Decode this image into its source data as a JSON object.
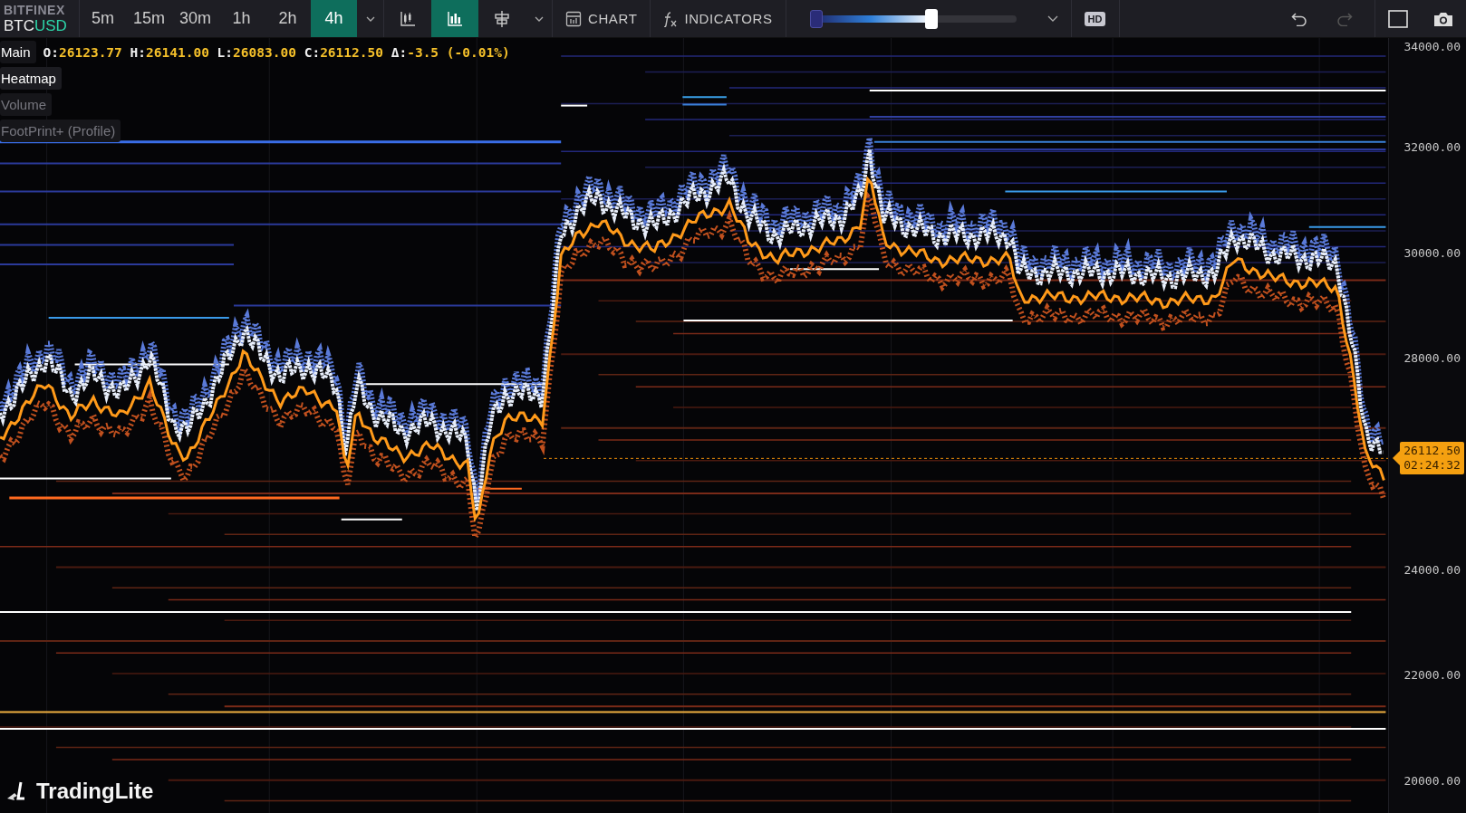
{
  "symbol": {
    "exchange": "BITFINEX",
    "base": "BTC",
    "quote": "USD"
  },
  "timeframes": [
    {
      "label": "5m",
      "selected": false
    },
    {
      "label": "15m",
      "selected": false
    },
    {
      "label": "30m",
      "selected": false
    },
    {
      "label": "1h",
      "selected": false
    },
    {
      "label": "2h",
      "selected": false
    },
    {
      "label": "4h",
      "selected": true
    }
  ],
  "chart_types": [
    {
      "kind": "candles",
      "selected": false
    },
    {
      "kind": "bars",
      "selected": true
    },
    {
      "kind": "crosshair",
      "selected": false
    }
  ],
  "buttons": [
    {
      "kind": "chart",
      "label": "CHART"
    },
    {
      "kind": "indicators",
      "label": "INDICATORS"
    }
  ],
  "range_slider": {
    "level": 0.59
  },
  "hd_badge": "HD",
  "history": {
    "undo_disabled": false,
    "redo_disabled": true
  },
  "legend": {
    "main_label": "Main",
    "readout": [
      {
        "label": "O:",
        "value": "26123.77"
      },
      {
        "label": "H:",
        "value": "26141.00"
      },
      {
        "label": "L:",
        "value": "26083.00"
      },
      {
        "label": "C:",
        "value": "26112.50"
      },
      {
        "label": "Δ:",
        "value": "-3.5 (-0.01%)"
      }
    ],
    "layers": [
      {
        "label": "Heatmap",
        "visible": true
      },
      {
        "label": "Volume",
        "visible": false
      },
      {
        "label": "FootPrint+ (Profile)",
        "visible": false
      }
    ]
  },
  "price_axis": [
    "34000.00",
    "32000.00",
    "30000.00",
    "28000.00",
    "24000.00",
    "22000.00",
    "20000.00"
  ],
  "current_price": {
    "price": "26112.50",
    "countdown": "02:24:32"
  },
  "logo": "TradingLite"
}
